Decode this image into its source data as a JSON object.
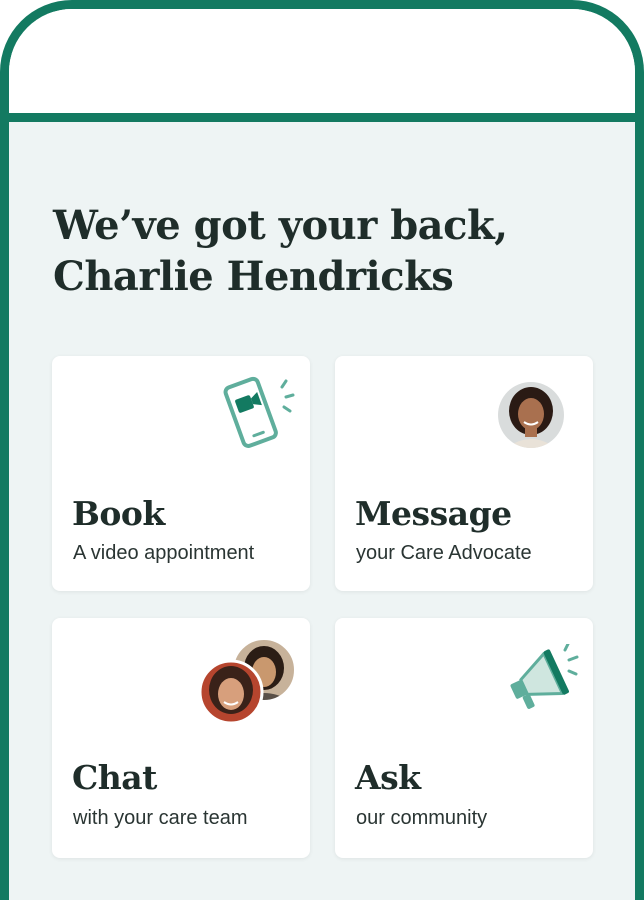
{
  "greeting": {
    "line1": "We’ve got your back,",
    "line2": "Charlie Hendricks"
  },
  "cards": [
    {
      "title": "Book",
      "subtitle": "A video appointment",
      "icon": "video-phone-icon"
    },
    {
      "title": "Message",
      "subtitle": "your Care Advocate",
      "icon": "care-advocate-avatar"
    },
    {
      "title": "Chat",
      "subtitle": "with your care team",
      "icon": "care-team-avatars"
    },
    {
      "title": "Ask",
      "subtitle": "our community",
      "icon": "megaphone-icon"
    }
  ],
  "colors": {
    "frame": "#137a61",
    "accent_icon": "#5fae9c",
    "background": "#eef4f4",
    "heading_text": "#1f2d2a"
  }
}
